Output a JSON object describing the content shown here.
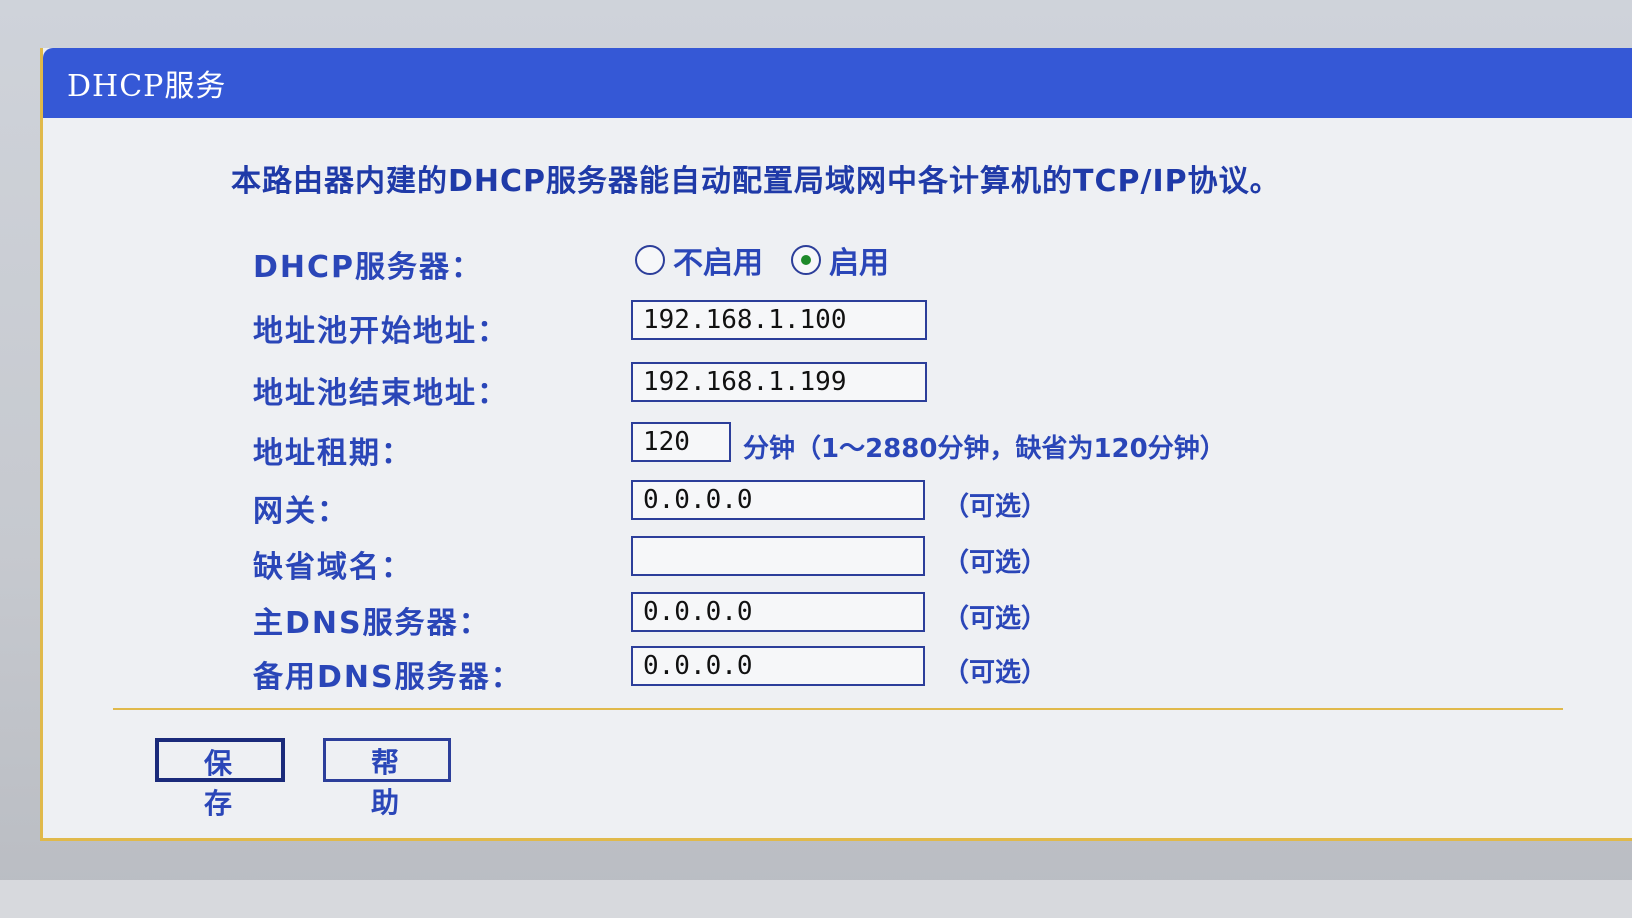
{
  "panel": {
    "title": "DHCP服务",
    "intro": "本路由器内建的DHCP服务器能自动配置局域网中各计算机的TCP/IP协议。"
  },
  "form": {
    "dhcp_server": {
      "label": "DHCP服务器：",
      "options": [
        "不启用",
        "启用"
      ],
      "selected": "启用"
    },
    "pool_start": {
      "label": "地址池开始地址：",
      "value": "192.168.1.100"
    },
    "pool_end": {
      "label": "地址池结束地址：",
      "value": "192.168.1.199"
    },
    "lease": {
      "label": "地址租期：",
      "value": "120",
      "unit_hint": "分钟（1～2880分钟，缺省为120分钟）"
    },
    "gateway": {
      "label": "网关：",
      "value": "0.0.0.0",
      "hint": "（可选）"
    },
    "domain": {
      "label": "缺省域名：",
      "value": "",
      "hint": "（可选）"
    },
    "primary_dns": {
      "label": "主DNS服务器：",
      "value": "0.0.0.0",
      "hint": "（可选）"
    },
    "secondary_dns": {
      "label": "备用DNS服务器：",
      "value": "0.0.0.0",
      "hint": "（可选）"
    }
  },
  "buttons": {
    "save": "保存",
    "help": "帮助"
  },
  "colors": {
    "title_bar": "#3558d6",
    "label_text": "#2a46b8",
    "border_accent": "#e0b94a"
  }
}
